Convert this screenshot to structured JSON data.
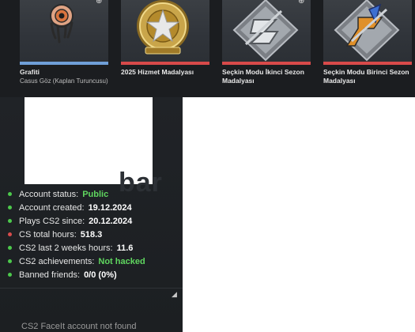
{
  "inventory": [
    {
      "name": "Grafiti",
      "subtitle": "Casus Göz (Kaplan Turuncusu)",
      "rarity_color": "#6f9fd8",
      "icon": "eye-graffiti-icon"
    },
    {
      "name": "2025 Hizmet Madalyası",
      "subtitle": "",
      "rarity_color": "#d84a4a",
      "icon": "star-medal-icon"
    },
    {
      "name": "Seçkin Modu İkinci Sezon Madalyası",
      "subtitle": "",
      "rarity_color": "#d84a4a",
      "icon": "season-two-medal-icon"
    },
    {
      "name": "Seçkin Modu Birinci Sezon Madalyası",
      "subtitle": "",
      "rarity_color": "#d84a4a",
      "icon": "season-one-medal-icon"
    }
  ],
  "watermark": "bar",
  "stats": [
    {
      "label": "Account status:",
      "value": "Public",
      "dot_color": "#4cc94c",
      "value_color": "green"
    },
    {
      "label": "Account created:",
      "value": "19.12.2024",
      "dot_color": "#4cc94c",
      "value_color": "white"
    },
    {
      "label": "Plays CS2 since:",
      "value": "20.12.2024",
      "dot_color": "#4cc94c",
      "value_color": "white"
    },
    {
      "label": "CS total hours:",
      "value": "518.3",
      "dot_color": "#d94c4c",
      "value_color": "white"
    },
    {
      "label": "CS2 last 2 weeks hours:",
      "value": "11.6",
      "dot_color": "#4cc94c",
      "value_color": "white"
    },
    {
      "label": "CS2 achievements:",
      "value": "Not hacked",
      "dot_color": "#4cc94c",
      "value_color": "green"
    },
    {
      "label": "Banned friends:",
      "value": "0/0 (0%)",
      "dot_color": "#4cc94c",
      "value_color": "white"
    }
  ],
  "faceit_status": "CS2 FaceIt account not found"
}
